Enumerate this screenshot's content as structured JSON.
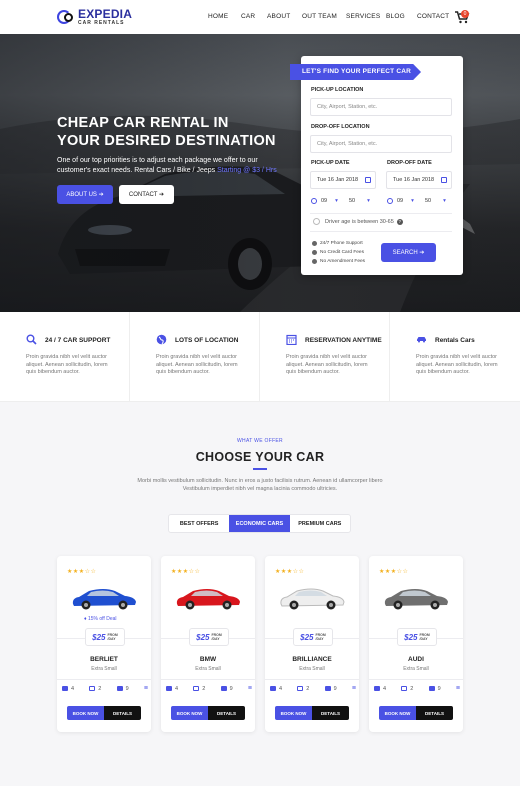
{
  "brand": {
    "name": "EXPEDIA",
    "tagline": "CAR RENTALS"
  },
  "nav": {
    "items": [
      "HOME",
      "CAR",
      "ABOUT",
      "OUT TEAM",
      "SERVICES",
      "BLOG",
      "CONTACT"
    ],
    "cart_count": "0"
  },
  "hero": {
    "title_line1": "CHEAP CAR RENTAL IN",
    "title_line2": "YOUR DESIRED DESTINATION",
    "desc": "One of our top priorities is to adjust each package we offer to our customer's exact needs. Rental Cars / Bike / Jeeps ",
    "desc_accent": "Starting @ $3 / Hrs",
    "about_label": "ABOUT US ➔",
    "contact_label": "CONTACT ➔"
  },
  "search_form": {
    "title": "LET'S FIND YOUR PERFECT CAR",
    "pickup_location_label": "PICK-UP LOCATION",
    "pickup_location_placeholder": "City, Airport, Station, etc.",
    "dropoff_location_label": "DROP-OFF LOCATION",
    "dropoff_location_placeholder": "City, Airport, Station, etc.",
    "pickup_date_label": "PICK-UP DATE",
    "pickup_date": "Tue 16 Jan 2018",
    "dropoff_date_label": "DROP-OFF DATE",
    "dropoff_date": "Tue 16 Jan 2018",
    "pickup_hour": "09",
    "pickup_min": "50",
    "dropoff_hour": "09",
    "dropoff_min": "50",
    "age_label": "Driver age is between 30-65",
    "features": [
      "24/7 Phone Support",
      "No Credit Card Fees",
      "No Amendment Fees"
    ],
    "search_label": "SEARCH ➔"
  },
  "features": [
    {
      "title": "24 / 7 CAR SUPPORT",
      "desc": "Proin gravida nibh vel velit auctor aliquet. Aenean sollicitudin, lorem quis bibendum auctor.",
      "icon": "search-icon"
    },
    {
      "title": "LOTS OF LOCATION",
      "desc": "Proin gravida nibh vel velit auctor aliquet. Aenean sollicitudin, lorem quis bibendum auctor.",
      "icon": "globe-icon"
    },
    {
      "title": "RESERVATION ANYTIME",
      "desc": "Proin gravida nibh vel velit auctor aliquet. Aenean sollicitudin, lorem quis bibendum auctor.",
      "icon": "calendar-icon"
    },
    {
      "title": "Rentals Cars",
      "desc": "Proin gravida nibh vel velit auctor aliquet. Aenean sollicitudin, lorem quis bibendum auctor.",
      "icon": "car-icon"
    }
  ],
  "offers": {
    "subtitle": "WHAT WE OFFER",
    "title": "CHOOSE YOUR CAR",
    "desc": "Morbi mollis vestibulum sollicitudin. Nunc in eros a justo facilisis rutrum. Aenean id ullamcorper libero Vestibulum imperdiet nibh vel magna lacinia commodo ultricies.",
    "tabs": [
      "BEST OFFERS",
      "ECONOMIC CARS",
      "PREMIUM CARS"
    ],
    "active_tab": 1
  },
  "cars": [
    {
      "name": "BERLIET",
      "type": "Extra Small",
      "price": "$25",
      "per_top": "FROM",
      "per_bottom": "/DAY",
      "deal": "15% off Deal",
      "rating": 3,
      "seats": "4",
      "doors": "2",
      "bags": "9",
      "color": "#1f4fd0"
    },
    {
      "name": "BMW",
      "type": "Extra Small",
      "price": "$25",
      "per_top": "FROM",
      "per_bottom": "/DAY",
      "deal": "",
      "rating": 3,
      "seats": "4",
      "doors": "2",
      "bags": "9",
      "color": "#d8161d"
    },
    {
      "name": "BRILLIANCE",
      "type": "Extra Small",
      "price": "$25",
      "per_top": "FROM",
      "per_bottom": "/DAY",
      "deal": "",
      "rating": 3,
      "seats": "4",
      "doors": "2",
      "bags": "9",
      "color": "#eeeeee"
    },
    {
      "name": "AUDI",
      "type": "Extra Small",
      "price": "$25",
      "per_top": "FROM",
      "per_bottom": "/DAY",
      "deal": "",
      "rating": 3,
      "seats": "4",
      "doors": "2",
      "bags": "9",
      "color": "#6f6f6f"
    }
  ],
  "card_buttons": {
    "book": "BOOK NOW",
    "details": "DETAILS"
  },
  "colors": {
    "accent": "#4a51e4",
    "star": "#f3b11f"
  }
}
